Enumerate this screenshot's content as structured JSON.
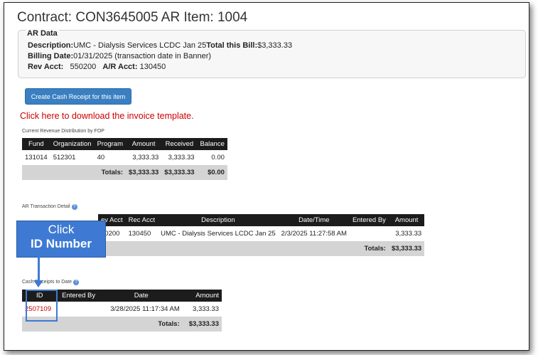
{
  "page": {
    "title": "Contract: CON3645005 AR Item: 1004"
  },
  "ar_data": {
    "legend": "AR Data",
    "description_label": "Description:",
    "description_value": "UMC - Dialysis Services LCDC Jan 25",
    "total_label": "Total this Bill:",
    "total_value": "$3,333.33",
    "billing_label": "Billing Date:",
    "billing_value": "01/31/2025 (transaction date in Banner)",
    "rev_acct_label": "Rev Acct:",
    "rev_acct_value": "550200",
    "ar_acct_label": "A/R Acct:",
    "ar_acct_value": "130450"
  },
  "actions": {
    "create_receipt": "Create Cash Receipt for this item",
    "download_link": "Click here to download the invoice template."
  },
  "revenue": {
    "caption": "Current Revenue Distribution by FOP",
    "headers": [
      "Fund",
      "Organization",
      "Program",
      "Amount",
      "Received",
      "Balance"
    ],
    "row": [
      "131014",
      "512301",
      "40",
      "3,333.33",
      "3,333.33",
      "0.00"
    ],
    "totals_label": "Totals:",
    "totals": [
      "$3,333.33",
      "$3,333.33",
      "$0.00"
    ]
  },
  "ar_transactions": {
    "caption": "AR Transaction Detail",
    "headers": [
      "ev Acct",
      "Rec Acct",
      "Description",
      "Date/Time",
      "Entered By",
      "Amount"
    ],
    "row": [
      "50200",
      "130450",
      "UMC - Dialysis Services LCDC Jan 25",
      "2/3/2025 11:27:58 AM",
      "",
      "3,333.33"
    ],
    "totals_label": "Totals:",
    "totals_value": "$3,333.33"
  },
  "cash_receipts": {
    "caption": "Cash Receipts to Date",
    "headers": [
      "ID",
      "Entered By",
      "Date",
      "Amount"
    ],
    "row": [
      "2507109",
      "",
      "3/28/2025 11:17:34 AM",
      "3,333.33"
    ],
    "totals_label": "Totals:",
    "totals_value": "$3,333.33"
  },
  "callout": {
    "line1": "Click",
    "line2": "ID Number"
  },
  "colors": {
    "accent": "#3e7ad3",
    "link_red": "#cc0000",
    "header_bg": "#1c1c1c",
    "totals_bg": "#d4d4d4"
  },
  "icons": {
    "help": "help-icon"
  }
}
